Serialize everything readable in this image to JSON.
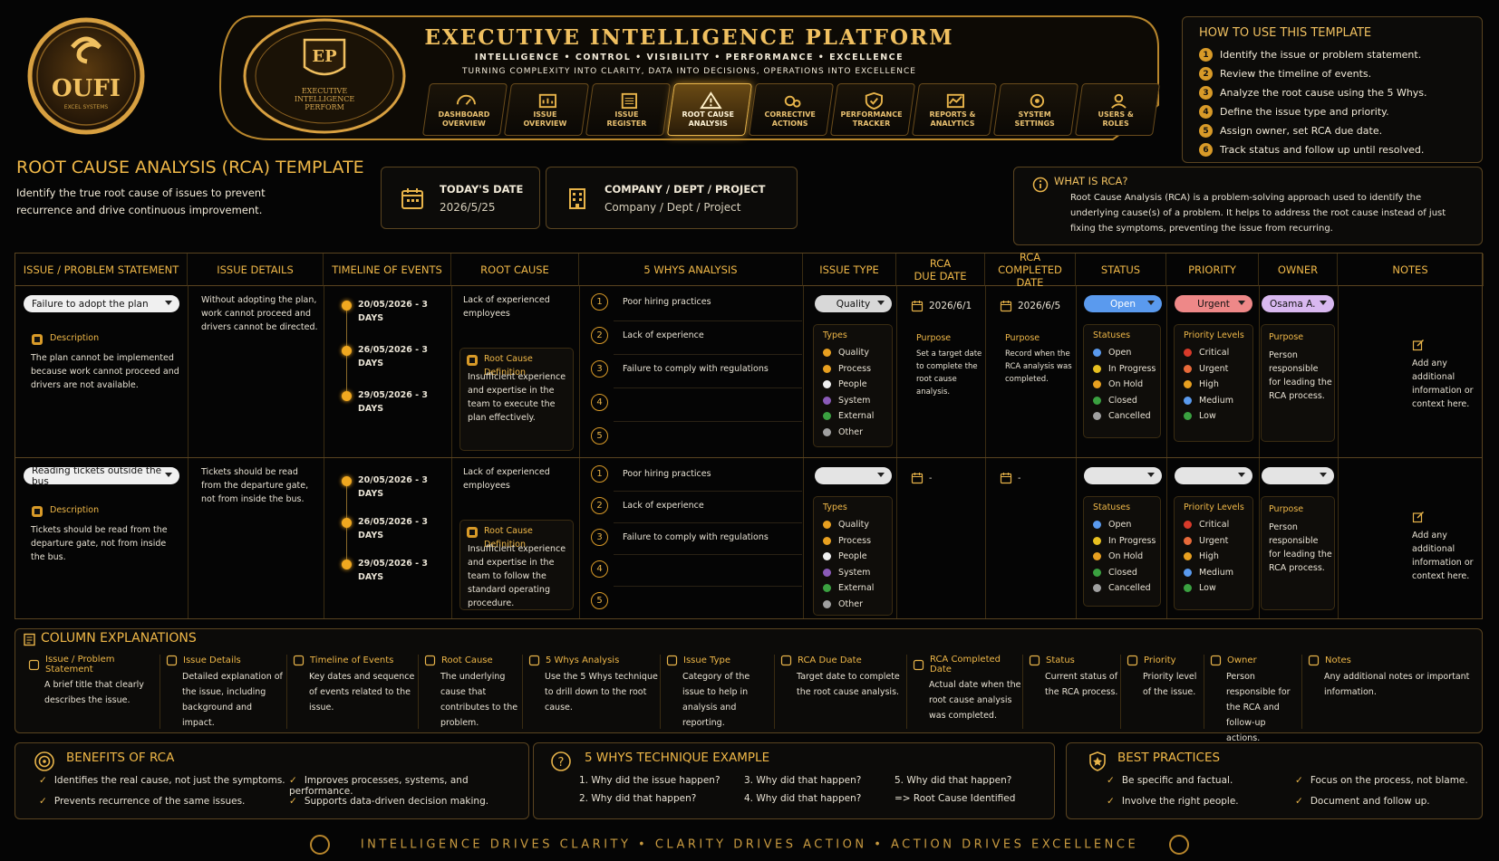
{
  "brand": {
    "logo_text": "OUFI",
    "logo_sub": "EXCEL SYSTEMS",
    "emblem_text": "EXECUTIVE INTELLIGENCE PERFORM"
  },
  "banner": {
    "title": "EXECUTIVE INTELLIGENCE PLATFORM",
    "pillars": "INTELLIGENCE  •  CONTROL  •  VISIBILITY  •  PERFORMANCE  •  EXCELLENCE",
    "tagline": "TURNING COMPLEXITY INTO CLARITY, DATA INTO DECISIONS, OPERATIONS INTO EXCELLENCE"
  },
  "nav": [
    {
      "l1": "DASHBOARD",
      "l2": "OVERVIEW",
      "icon": "dashboard-icon"
    },
    {
      "l1": "ISSUE",
      "l2": "OVERVIEW",
      "icon": "issue-overview-icon"
    },
    {
      "l1": "ISSUE",
      "l2": "REGISTER",
      "icon": "register-icon"
    },
    {
      "l1": "ROOT CAUSE",
      "l2": "ANALYSIS",
      "icon": "warning-icon",
      "active": true
    },
    {
      "l1": "CORRECTIVE",
      "l2": "ACTIONS",
      "icon": "gears-icon"
    },
    {
      "l1": "PERFORMANCE",
      "l2": "TRACKER",
      "icon": "shield-icon"
    },
    {
      "l1": "REPORTS &",
      "l2": "ANALYTICS",
      "icon": "chart-icon"
    },
    {
      "l1": "SYSTEM",
      "l2": "SETTINGS",
      "icon": "settings-icon"
    },
    {
      "l1": "USERS &",
      "l2": "ROLES",
      "icon": "users-icon"
    }
  ],
  "howto": {
    "title": "HOW TO USE THIS TEMPLATE",
    "steps": [
      "Identify the issue or problem statement.",
      "Review the timeline of events.",
      "Analyze the root cause using the 5 Whys.",
      "Define the issue type and priority.",
      "Assign owner, set RCA due date.",
      "Track status and follow up until resolved."
    ]
  },
  "page": {
    "title": "ROOT CAUSE ANALYSIS (RCA) TEMPLATE",
    "subtitle": "Identify the true root cause of issues to prevent recurrence and drive continuous improvement."
  },
  "today": {
    "label": "TODAY'S DATE",
    "value": "2026/5/25"
  },
  "company": {
    "label": "COMPANY / DEPT / PROJECT",
    "value": "Company / Dept / Project"
  },
  "whatis": {
    "title": "WHAT IS RCA?",
    "text": "Root Cause Analysis (RCA) is a problem-solving approach used to identify the underlying cause(s) of a problem. It helps to address the root cause instead of just fixing the symptoms, preventing the issue from recurring."
  },
  "table": {
    "headers": {
      "issue": "ISSUE / PROBLEM STATEMENT",
      "details": "ISSUE DETAILS",
      "timeline": "TIMELINE OF EVENTS",
      "root": "ROOT CAUSE",
      "whys": "5 WHYS ANALYSIS",
      "type": "ISSUE TYPE",
      "due": "RCA\nDUE DATE",
      "completed": "RCA\nCOMPLETED DATE",
      "status": "STATUS",
      "priority": "PRIORITY",
      "owner": "OWNER",
      "notes": "NOTES"
    },
    "desc_label": "Description",
    "rcd_label": "Root Cause Definition",
    "types_label": "Types",
    "types": [
      "Quality",
      "Process",
      "People",
      "System",
      "External",
      "Other"
    ],
    "statuses_label": "Statuses",
    "statuses": [
      "Open",
      "In Progress",
      "On Hold",
      "Closed",
      "Cancelled"
    ],
    "priority_label": "Priority Levels",
    "priorities": [
      "Critical",
      "Urgent",
      "High",
      "Medium",
      "Low"
    ],
    "purpose_label": "Purpose",
    "due_purpose": "Set a target date to complete the root cause analysis.",
    "completed_purpose": "Record when the RCA analysis was completed.",
    "owner_purpose": "Person responsible for leading the RCA process.",
    "notes_text": "Add any additional information or context here.",
    "rows": [
      {
        "issue": "Failure to adopt the plan",
        "description": "The plan cannot be implemented because work cannot proceed and drivers are not available.",
        "details": "Without adopting the plan, work cannot proceed and drivers cannot be directed.",
        "timeline": [
          "20/05/2026 - 3 DAYS",
          "26/05/2026 - 3 DAYS",
          "29/05/2026 - 3 DAYS"
        ],
        "root_cause": "Lack of experienced employees",
        "root_def": "Insufficient experience and expertise in the team to execute the plan effectively.",
        "whys": [
          "Poor hiring practices",
          "Lack of experience",
          "Failure to comply with regulations",
          "",
          ""
        ],
        "type": "Quality",
        "due": "2026/6/1",
        "completed": "2026/6/5",
        "status": "Open",
        "priority": "Urgent",
        "owner": "Osama A."
      },
      {
        "issue": "Reading tickets outside the bus",
        "description": "Tickets should be read from the departure gate, not from inside the bus.",
        "details": "Tickets should be read from the departure gate, not from inside the bus.",
        "timeline": [
          "20/05/2026 - 3 DAYS",
          "26/05/2026 - 3 DAYS",
          "29/05/2026 - 3 DAYS"
        ],
        "root_cause": "Lack of experienced employees",
        "root_def": "Insufficient experience and expertise in the team to follow the standard operating procedure.",
        "whys": [
          "Poor hiring practices",
          "Lack of experience",
          "Failure to comply with regulations",
          "",
          ""
        ],
        "type": "",
        "due": "-",
        "completed": "-",
        "status": "",
        "priority": "",
        "owner": ""
      }
    ]
  },
  "colexp": {
    "title": "COLUMN EXPLANATIONS",
    "items": [
      {
        "h": "Issue / Problem Statement",
        "d": "A brief title that clearly describes the issue."
      },
      {
        "h": "Issue Details",
        "d": "Detailed explanation of the issue, including background and impact."
      },
      {
        "h": "Timeline of Events",
        "d": "Key dates and sequence of events related to the issue."
      },
      {
        "h": "Root Cause",
        "d": "The underlying cause that contributes to the problem."
      },
      {
        "h": "5 Whys Analysis",
        "d": "Use the 5 Whys technique to drill down to the root cause."
      },
      {
        "h": "Issue Type",
        "d": "Category of the issue to help in analysis and reporting."
      },
      {
        "h": "RCA Due Date",
        "d": "Target date to complete the root cause analysis."
      },
      {
        "h": "RCA Completed Date",
        "d": "Actual date when the root cause analysis was completed."
      },
      {
        "h": "Status",
        "d": "Current status of the RCA process."
      },
      {
        "h": "Priority",
        "d": "Priority level of the issue."
      },
      {
        "h": "Owner",
        "d": "Person responsible for the RCA and follow-up actions."
      },
      {
        "h": "Notes",
        "d": "Any additional notes or important information."
      }
    ]
  },
  "benefits": {
    "title": "BENEFITS OF RCA",
    "items": [
      "Identifies the real cause, not just the symptoms.",
      "Improves processes, systems, and performance.",
      "Prevents recurrence of the same issues.",
      "Supports data-driven decision making."
    ]
  },
  "whys_example": {
    "title": "5 WHYS TECHNIQUE EXAMPLE",
    "items": [
      "1. Why did the issue happen?",
      "3. Why did that happen?",
      "5. Why did that happen?",
      "2. Why did that happen?",
      "4. Why did that happen?",
      "=> Root Cause Identified"
    ]
  },
  "best": {
    "title": "BEST PRACTICES",
    "items": [
      "Be specific and factual.",
      "Focus on the process, not blame.",
      "Involve the right people.",
      "Document and follow up."
    ]
  },
  "footer": "INTELLIGENCE DRIVES CLARITY  •  CLARITY DRIVES ACTION  •  ACTION DRIVES EXCELLENCE",
  "colors": {
    "gold": "#e8b44a",
    "background": "#050505",
    "type_colors": [
      "#e8a020",
      "#e8a020",
      "#f0f0f0",
      "#8a5ab8",
      "#3aa040",
      "#a0a0a0"
    ],
    "status_colors": [
      "#5a9aee",
      "#e8c020",
      "#e8a020",
      "#3aa040",
      "#a0a0a0"
    ],
    "priority_colors": [
      "#d83a2a",
      "#e86a3a",
      "#e8a020",
      "#5a9aee",
      "#3aa040"
    ]
  }
}
